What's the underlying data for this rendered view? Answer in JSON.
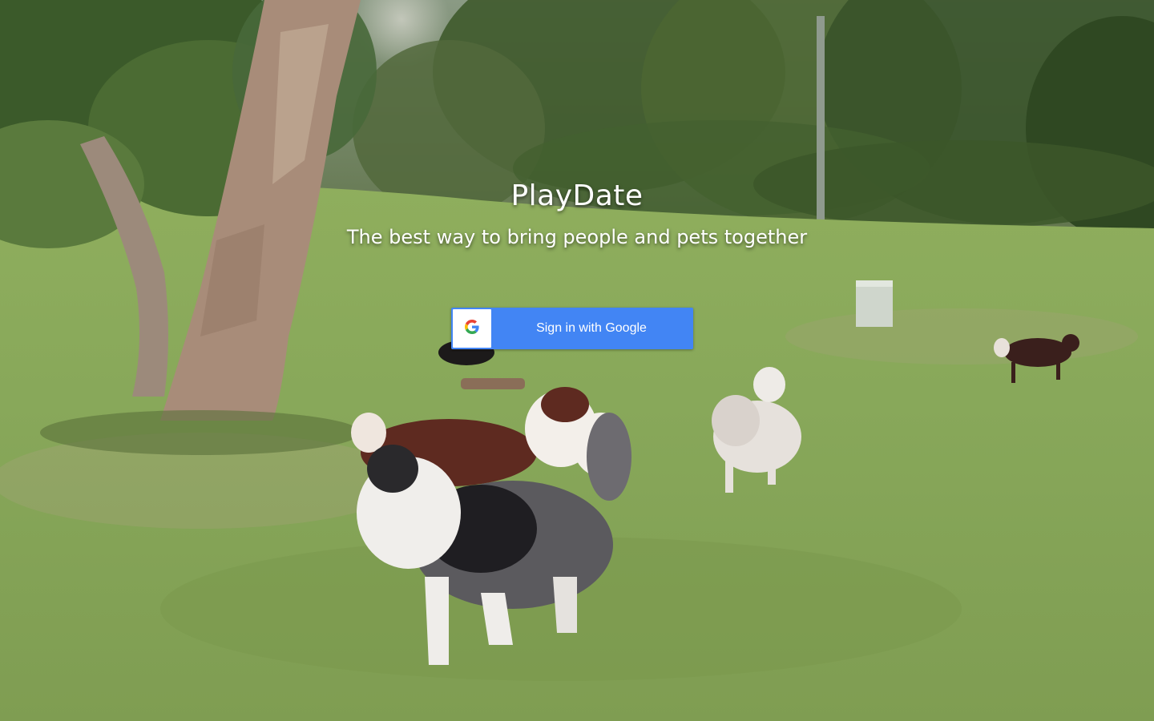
{
  "app": {
    "title": "PlayDate",
    "tagline": "The best way to bring people and pets together"
  },
  "signin": {
    "label": "Sign in with Google",
    "icon": "google-g-icon",
    "button_color": "#4285f4"
  },
  "background": {
    "description_icon": "dog-park-photo"
  }
}
